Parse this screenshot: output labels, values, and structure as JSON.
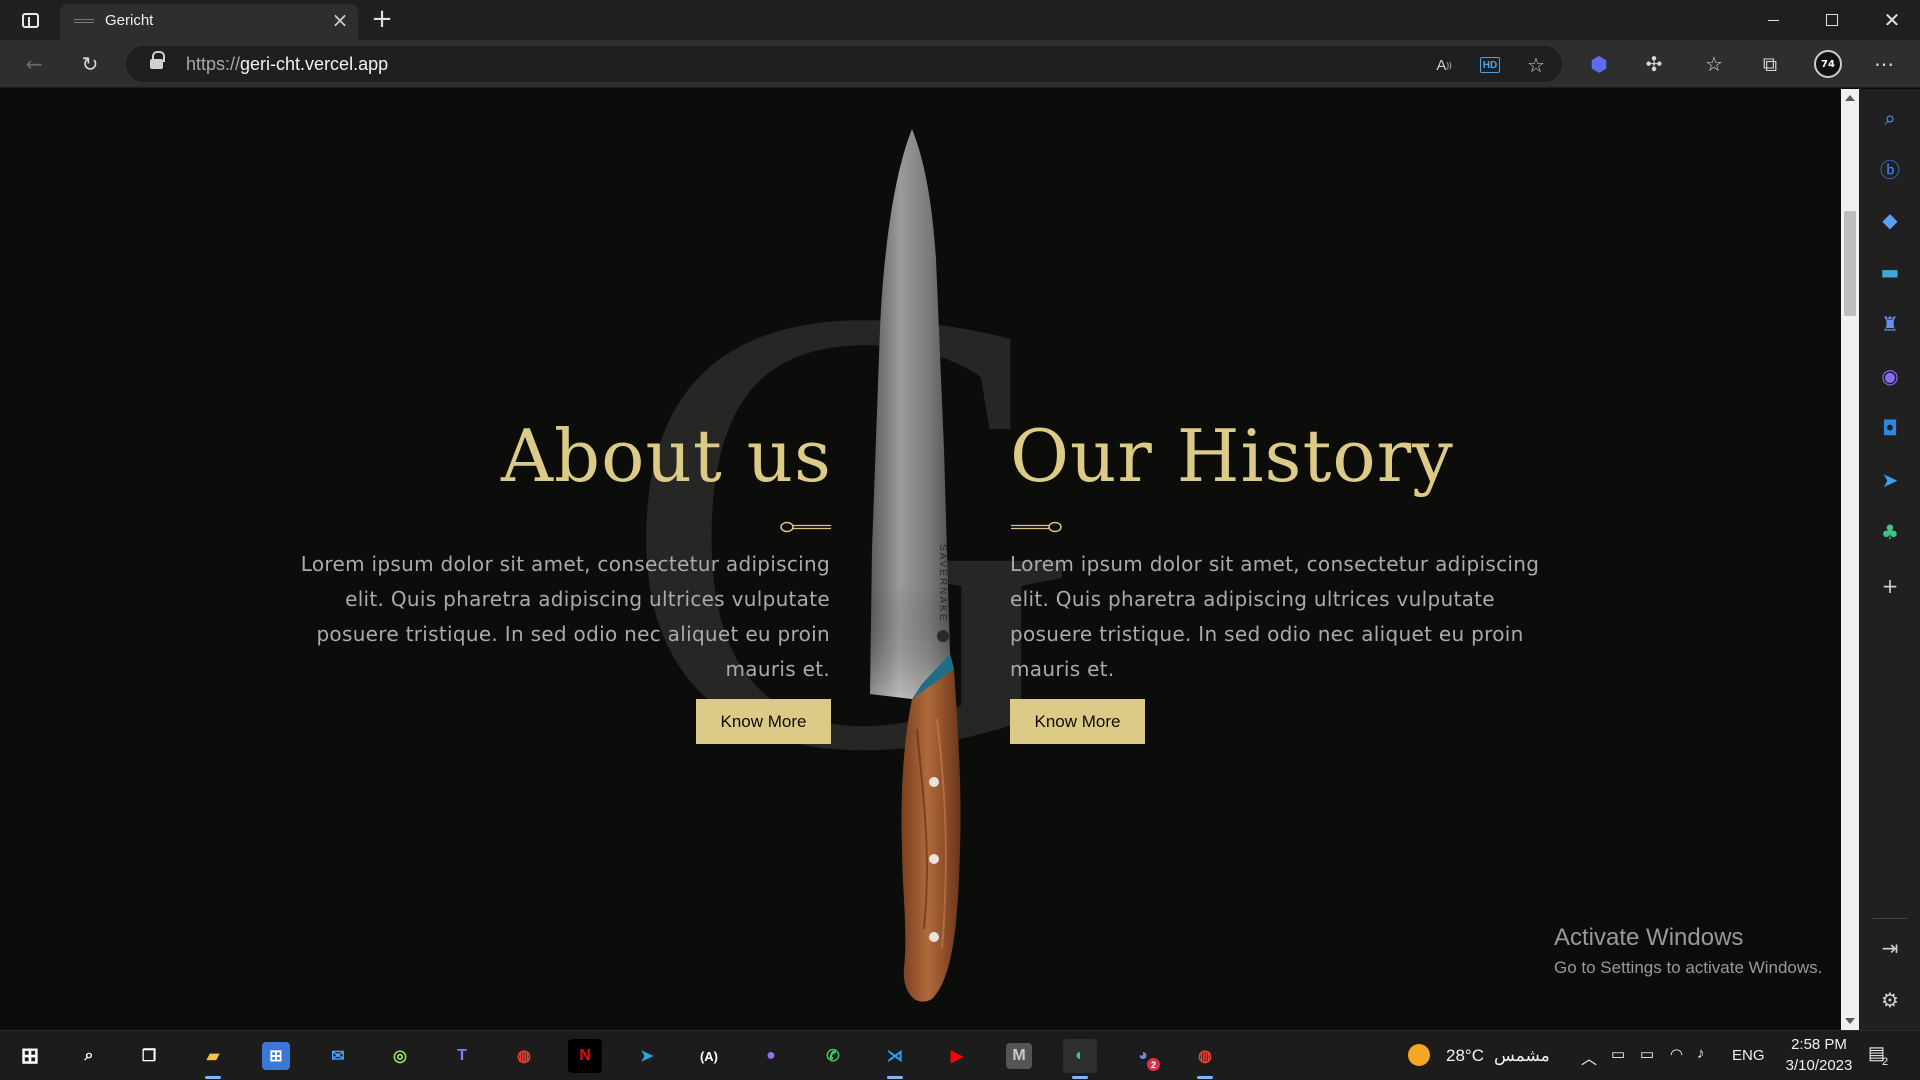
{
  "browser": {
    "tab_title": "Gericht",
    "url_scheme": "https://",
    "url_host": "geri-cht.vercel.app"
  },
  "page": {
    "about": {
      "title": "About us",
      "text": "Lorem ipsum dolor sit amet, consectetur adipiscing elit. Quis pharetra adipiscing ultrices vulputate posuere tristique. In sed odio nec aliquet eu proin mauris et.",
      "button": "Know More"
    },
    "history": {
      "title": "Our History",
      "text": "Lorem ipsum dolor sit amet, consectetur adipiscing elit. Quis pharetra adipiscing ultrices vulputate posuere tristique. In sed odio nec aliquet eu proin mauris et.",
      "button": "Know More"
    },
    "watermark_letter": "G",
    "knife_brand": "SAVERNAKE",
    "accent_color": "#dcca87"
  },
  "overlay": {
    "activate_title": "Activate Windows",
    "activate_sub": "Go to Settings to activate Windows."
  },
  "taskbar": {
    "weather": "28°C",
    "weather_desc": "مشمس",
    "lang": "ENG",
    "time": "2:58 PM",
    "date": "3/10/2023",
    "notifications": "2",
    "discord_badge": "2"
  }
}
